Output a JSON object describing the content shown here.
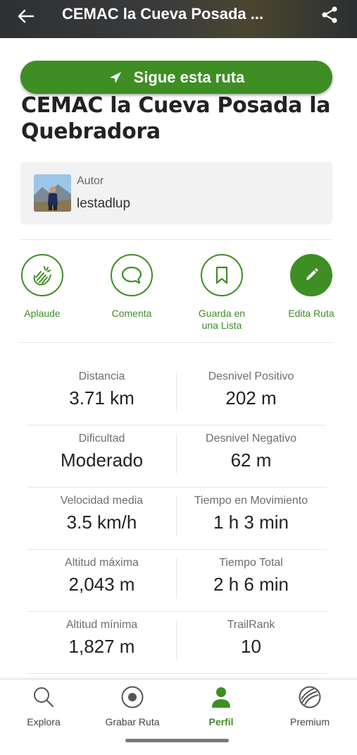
{
  "header": {
    "title": "CEMAC la Cueva Posada ..."
  },
  "follow_button": {
    "label": "Sigue esta ruta"
  },
  "route": {
    "title": "CEMAC la Cueva Posada la Quebradora"
  },
  "author": {
    "label": "Autor",
    "name": "lestadlup"
  },
  "actions": [
    {
      "label": "Aplaude",
      "icon": "clap-icon"
    },
    {
      "label": "Comenta",
      "icon": "comment-icon"
    },
    {
      "label": "Guarda en una Lista",
      "icon": "bookmark-icon"
    },
    {
      "label": "Edita Ruta",
      "icon": "pencil-icon"
    }
  ],
  "stats": [
    {
      "left": {
        "label": "Distancia",
        "value": "3.71 km"
      },
      "right": {
        "label": "Desnivel Positivo",
        "value": "202 m"
      }
    },
    {
      "left": {
        "label": "Dificultad",
        "value": "Moderado"
      },
      "right": {
        "label": "Desnivel Negativo",
        "value": "62 m"
      }
    },
    {
      "left": {
        "label": "Velocidad media",
        "value": "3.5 km/h"
      },
      "right": {
        "label": "Tiempo en Movimiento",
        "value": "1 h 3 min"
      }
    },
    {
      "left": {
        "label": "Altitud máxima",
        "value": "2,043 m"
      },
      "right": {
        "label": "Tiempo Total",
        "value": "2 h 6 min"
      }
    },
    {
      "left": {
        "label": "Altitud mínima",
        "value": "1,827 m"
      },
      "right": {
        "label": "TrailRank",
        "value": "10"
      }
    }
  ],
  "bottom_nav": [
    {
      "label": "Explora",
      "icon": "search-icon"
    },
    {
      "label": "Grabar Ruta",
      "icon": "record-icon"
    },
    {
      "label": "Perfil",
      "icon": "person-icon",
      "active": true
    },
    {
      "label": "Premium",
      "icon": "premium-icon"
    }
  ],
  "colors": {
    "accent": "#3e8e24",
    "author_bg": "#f2f2f2"
  }
}
